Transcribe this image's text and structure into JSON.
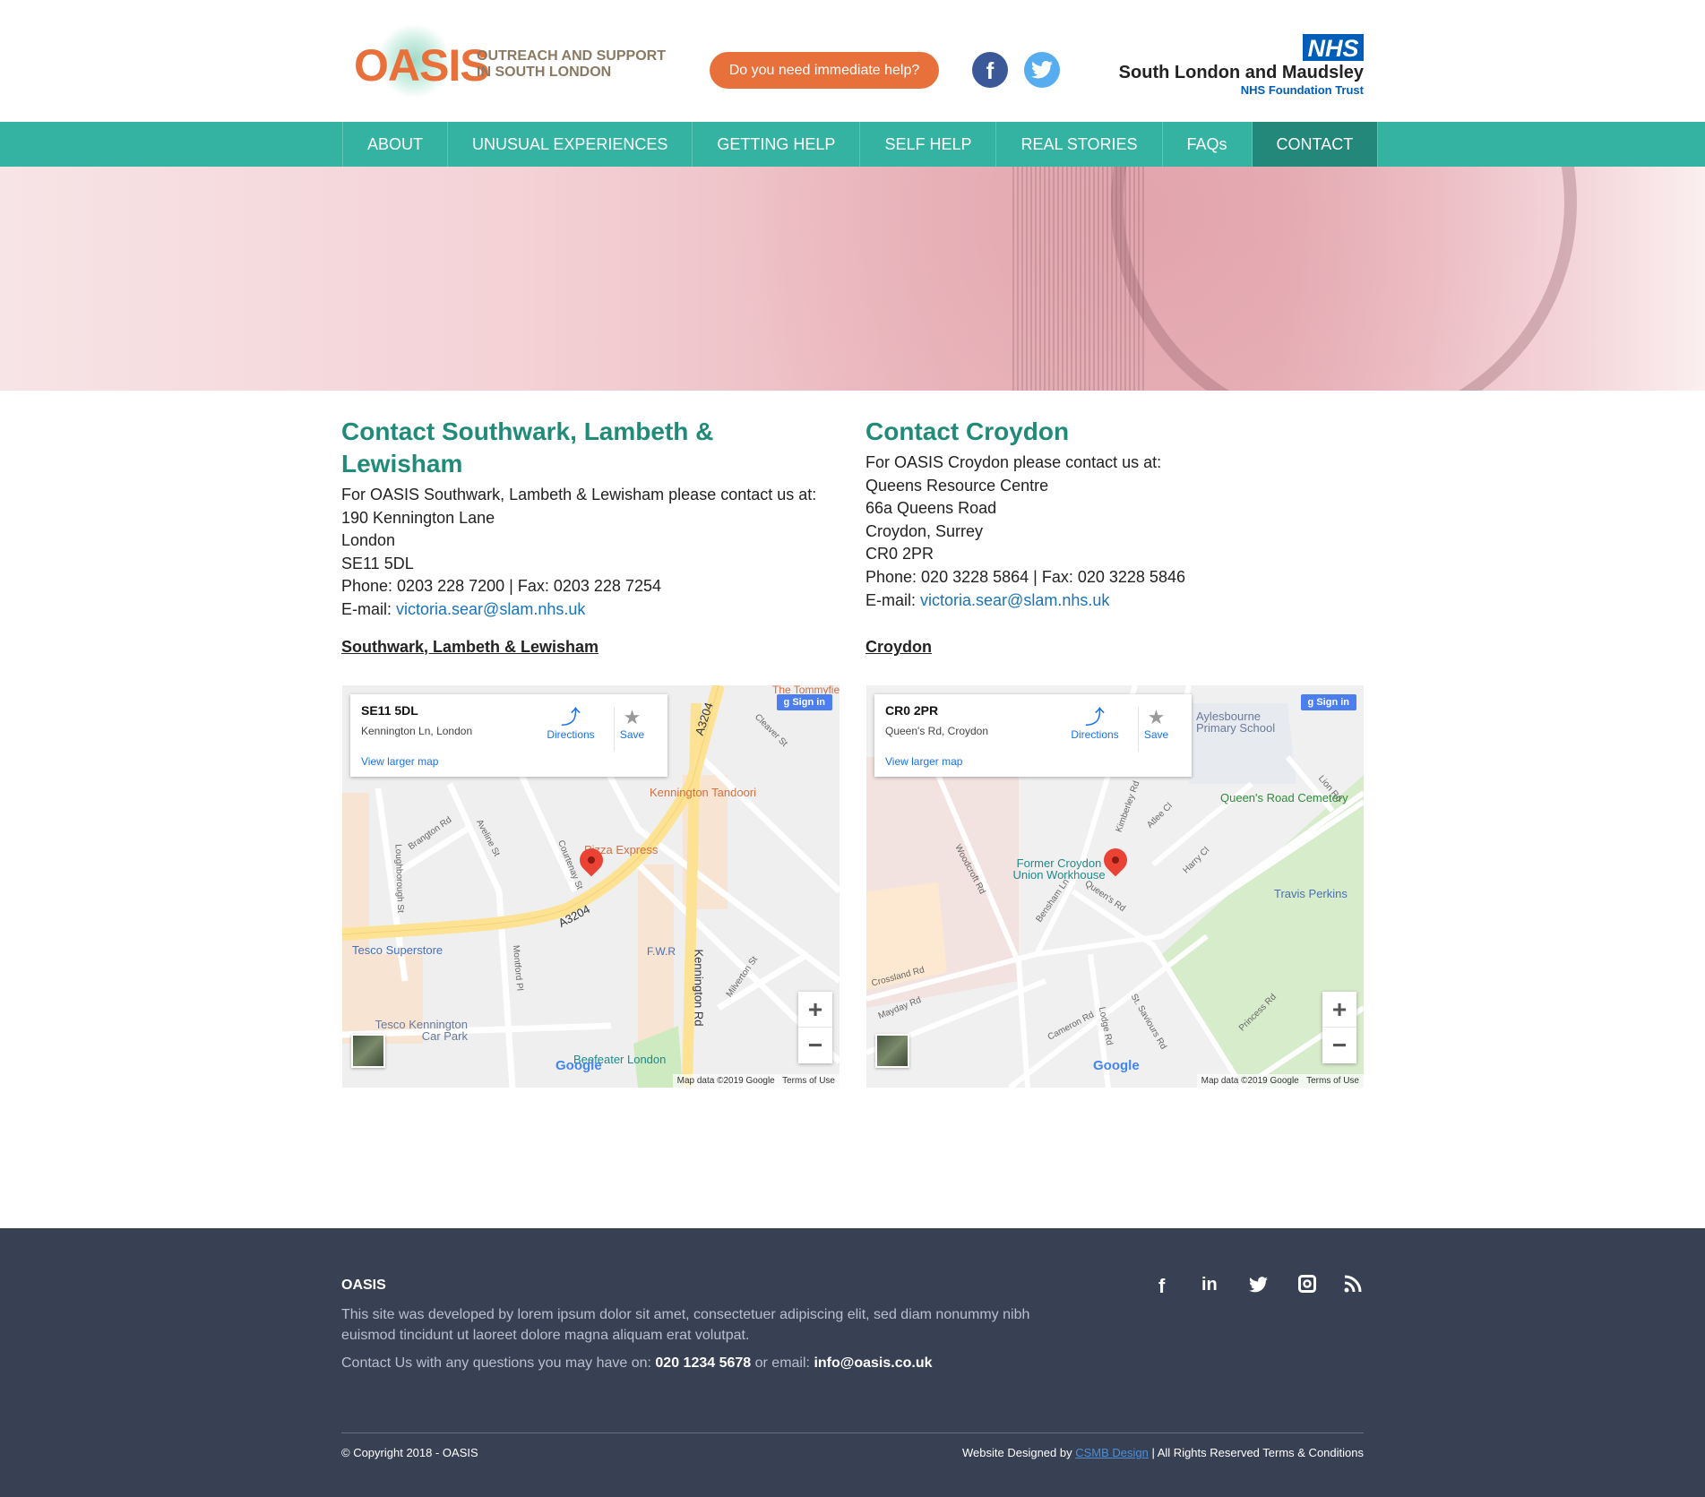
{
  "header": {
    "logo_word": "OASIS",
    "tagline": [
      "OUTREACH AND SUPPORT",
      "IN SOUTH LONDON"
    ],
    "help_button": "Do you need immediate help?",
    "social": [
      {
        "icon": "facebook-icon",
        "glyph": "f",
        "color": "#3b5998"
      },
      {
        "icon": "twitter-icon",
        "glyph": "t",
        "color": "#55acee"
      }
    ],
    "nhs_logo": "NHS",
    "trust_name": "South London and Maudsley",
    "trust_sub": "NHS Foundation Trust"
  },
  "nav": {
    "items": [
      "ABOUT",
      "UNUSUAL EXPERIENCES",
      "GETTING HELP",
      "SELF HELP",
      "REAL STORIES",
      "FAQs",
      "CONTACT"
    ],
    "active": "CONTACT"
  },
  "colors": {
    "accent": "#35b3a2",
    "nav_active": "#23877a",
    "heading": "#1f8b78",
    "orange": "#e8703a",
    "footer": "#384054"
  },
  "contacts": [
    {
      "title": "Contact Southwark, Lambeth & Lewisham",
      "lines": [
        "For OASIS Southwark, Lambeth & Lewisham please contact us at:",
        "190 Kennington Lane",
        "London",
        "SE11 5DL",
        "Phone: 0203 228 7200 | Fax: 0203 228 7254"
      ],
      "email_label": "E-mail: ",
      "email": "victoria.sear@slam.nhs.uk",
      "map_title": "Southwark, Lambeth & Lewisham",
      "map": {
        "place": "SE11 5DL",
        "address": "Kennington Ln, London",
        "directions": "Directions",
        "save": "Save",
        "view_larger": "View larger map",
        "sign_in": "Sign in",
        "attribution": "Map data ©2019 Google",
        "terms": "Terms of Use",
        "labels": [
          "Kennington Tandoori",
          "Pizza Express",
          "Tesco Superstore",
          "Tesco Kennington Car Park",
          "F.W.R",
          "Beefeater London",
          "A3204",
          "A3204",
          "Kennington Rd",
          "Brangton Rd",
          "Aveline St",
          "Courtenay St",
          "Loughborough St",
          "Montford Pl",
          "Cleaver St",
          "Milverton St",
          "The Tommyfield"
        ]
      }
    },
    {
      "title": "Contact Croydon",
      "lines": [
        "For OASIS Croydon please contact us at:",
        "Queens Resource Centre",
        "66a Queens Road",
        "Croydon, Surrey",
        "CR0 2PR",
        "Phone: 020 3228 5864 | Fax: 020 3228 5846"
      ],
      "email_label": "E-mail: ",
      "email": "victoria.sear@slam.nhs.uk",
      "map_title": "Croydon",
      "map": {
        "place": "CR0 2PR",
        "address": "Queen's Rd, Croydon",
        "directions": "Directions",
        "save": "Save",
        "view_larger": "View larger map",
        "sign_in": "Sign in",
        "attribution": "Map data ©2019 Google",
        "terms": "Terms of Use",
        "labels": [
          "Queen's Road Cemetery",
          "Former Croydon Union Workhouse",
          "Travis Perkins",
          "Aylesbourne Primary School",
          "Woodcroft Rd",
          "Bensham Ln",
          "Queen's Rd",
          "Crossland Rd",
          "Mayday Rd",
          "Cameron Rd",
          "Lodge Rd",
          "St. Saviours Rd",
          "Princess Rd",
          "Harry Cl",
          "Atlee Cl",
          "Kimberley Rd",
          "Lion Rd"
        ]
      }
    }
  ],
  "footer": {
    "title": "OASIS",
    "text": "This site was developed by lorem ipsum dolor sit amet, consectetuer adipiscing elit, sed diam nonummy nibh euismod tincidunt ut laoreet dolore magna aliquam erat volutpat.",
    "contact_prefix": "Contact Us with any questions you may have on: ",
    "phone": "020 1234 5678",
    "email_prefix": " or email: ",
    "email": "info@oasis.co.uk",
    "social": [
      "facebook-icon",
      "linkedin-icon",
      "twitter-icon",
      "instagram-icon",
      "rss-icon"
    ],
    "copyright": "© Copyright 2018 - OASIS",
    "designed_by": "Website Designed by ",
    "designer": "CSMB Design",
    "rights": " | All Rights Reserved Terms & Conditions"
  }
}
